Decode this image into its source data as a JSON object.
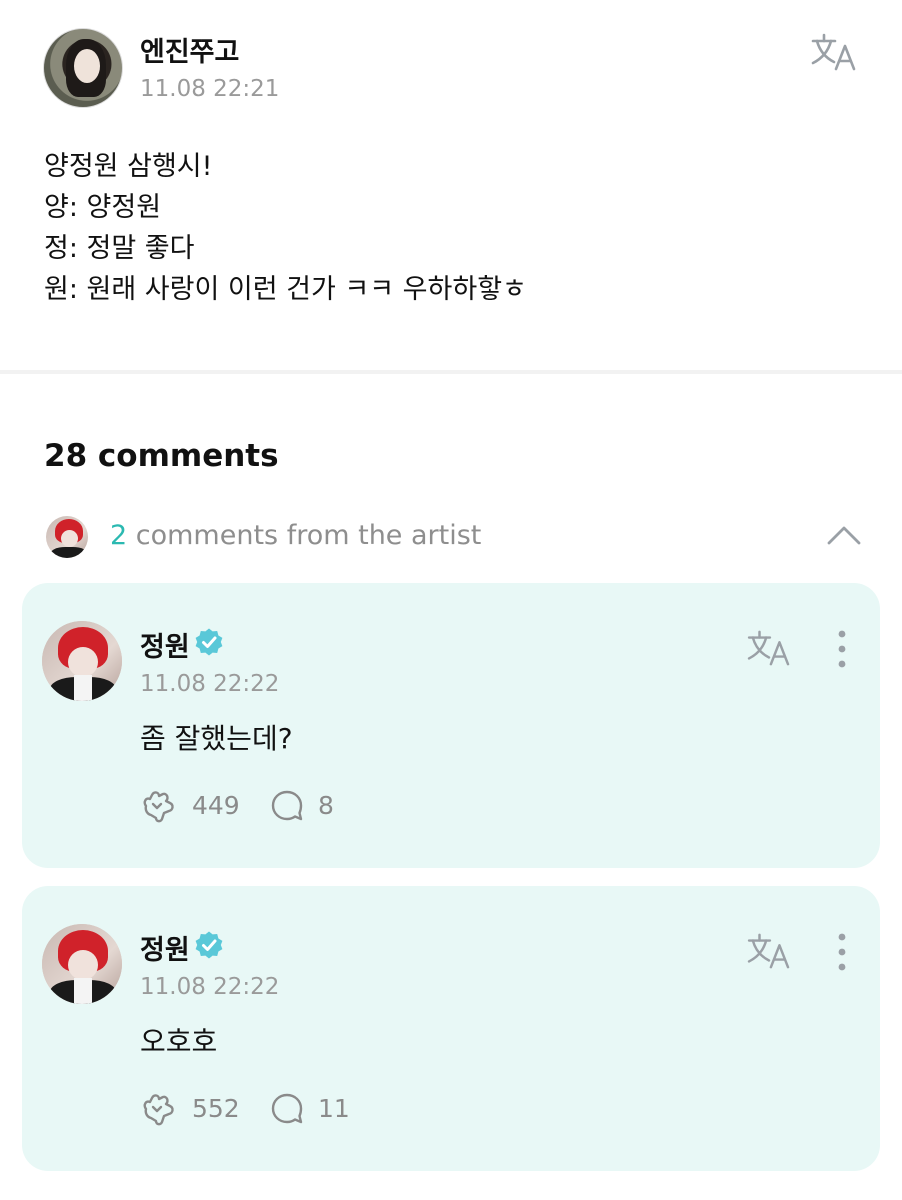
{
  "post": {
    "author": "엔진쭈고",
    "timestamp": "11.08 22:21",
    "translate_icon": "translate-icon",
    "body_lines": [
      "양정원 삼행시!",
      "양: 양정원",
      "정: 정말 좋다",
      "원: 원래 사랑이 이런 건가 ㅋㅋ 우하하핳ㅎ"
    ]
  },
  "comments": {
    "count_label": "28 comments",
    "artist_summary": {
      "count": "2",
      "text": " comments from the artist"
    },
    "artist_comments": [
      {
        "name": "정원",
        "timestamp": "11.08 22:22",
        "text": "좀 잘했는데?",
        "cheers": "449",
        "replies": "8"
      },
      {
        "name": "정원",
        "timestamp": "11.08 22:22",
        "text": "오호호",
        "cheers": "552",
        "replies": "11"
      }
    ]
  },
  "colors": {
    "accent": "#2bb9b1",
    "card_bg": "#e8f8f6",
    "muted_text": "#9a9a9a",
    "verified": "#5ac8d8"
  }
}
